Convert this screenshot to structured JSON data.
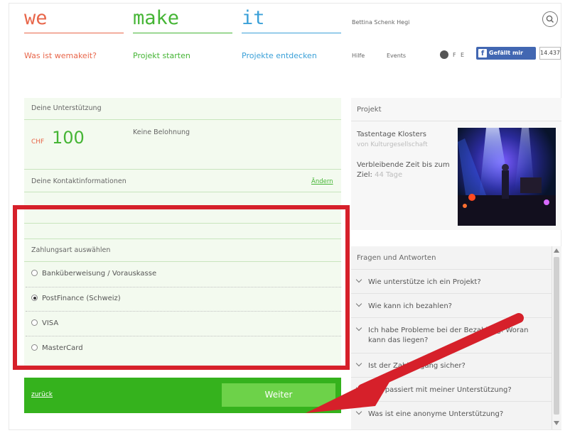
{
  "header": {
    "logo": {
      "we": "we",
      "make": "make",
      "it": "it"
    },
    "nav": [
      "Was ist wemakeit?",
      "Projekt starten",
      "Projekte entdecken"
    ],
    "user_name": "Bettina Schenk Hegi",
    "links": {
      "help": "Hilfe",
      "events": "Events"
    },
    "languages": [
      "F",
      "E"
    ],
    "fb_like": "Gefällt mir",
    "fb_count": "14.437"
  },
  "support": {
    "title": "Deine Unterstützung",
    "currency": "CHF",
    "amount": "100",
    "reward": "Keine Belohnung"
  },
  "contact": {
    "title": "Deine Kontaktinformationen",
    "edit": "Ändern"
  },
  "payment": {
    "title": "Zahlungsart auswählen",
    "options": [
      {
        "label": "Banküberweisung / Vorauskasse",
        "selected": false
      },
      {
        "label": "PostFinance (Schweiz)",
        "selected": true
      },
      {
        "label": "VISA",
        "selected": false
      },
      {
        "label": "MasterCard",
        "selected": false
      }
    ]
  },
  "footer": {
    "back": "zurück",
    "next": "Weiter"
  },
  "project": {
    "heading": "Projekt",
    "title": "Tastentage Klosters",
    "by": "von Kulturgesellschaft",
    "remaining_label": "Verbleibende Zeit bis zum Ziel:",
    "remaining_value": "44 Tage"
  },
  "faq": {
    "title": "Fragen und Antworten",
    "items": [
      "Wie unterstütze ich ein Projekt?",
      "Wie kann ich bezahlen?",
      "Ich habe Probleme bei der Bezahlung. Woran kann das liegen?",
      "Ist der Zahlvorgang sicher?",
      "Was passiert mit meiner Unterstützung?",
      "Was ist eine anonyme Unterstützung?"
    ]
  },
  "colors": {
    "accent_green": "#35b21d",
    "logo_orange": "#e8664a",
    "logo_green": "#45b535",
    "logo_blue": "#3aa0d8",
    "highlight_red": "#d6202a"
  }
}
